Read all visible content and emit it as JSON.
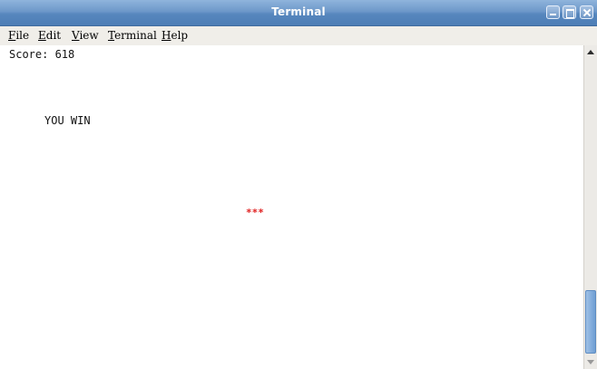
{
  "window": {
    "title": "Terminal"
  },
  "menubar": {
    "items": [
      {
        "mnemonic": "F",
        "rest": "ile"
      },
      {
        "mnemonic": "E",
        "rest": "dit"
      },
      {
        "mnemonic": "V",
        "rest": "iew"
      },
      {
        "mnemonic": "T",
        "rest": "erminal"
      },
      {
        "mnemonic": "H",
        "rest": "elp"
      }
    ]
  },
  "terminal": {
    "score_line": "Score: 618",
    "message": "YOU WIN",
    "marker": "***",
    "marker_color": "#e02020"
  },
  "scrollbar": {
    "icons": {
      "up": "scroll-up-arrow-icon",
      "down": "scroll-down-arrow-icon"
    },
    "thumb_color": "#7aa7d9"
  },
  "colors": {
    "titlebar": "#6d98c9",
    "menubar_bg": "#f0eee9",
    "terminal_bg": "#ffffff",
    "terminal_fg": "#111111"
  }
}
